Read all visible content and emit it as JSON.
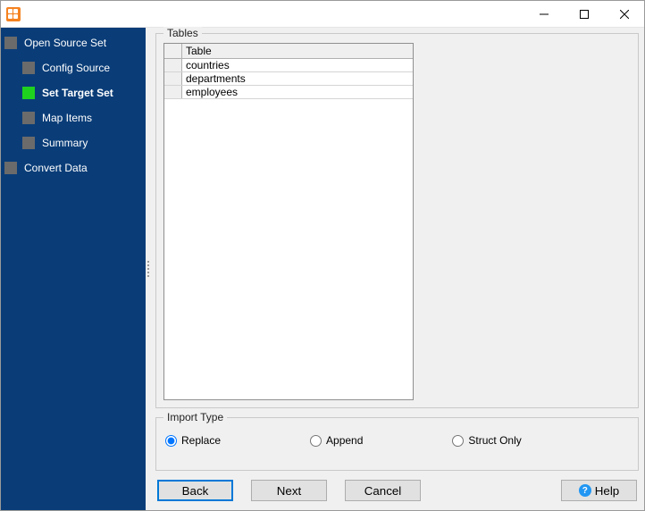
{
  "sidebar": {
    "steps": [
      {
        "label": "Open Source Set",
        "indent": false,
        "current": false
      },
      {
        "label": "Config Source",
        "indent": true,
        "current": false
      },
      {
        "label": "Set Target Set",
        "indent": true,
        "current": true
      },
      {
        "label": "Map Items",
        "indent": true,
        "current": false
      },
      {
        "label": "Summary",
        "indent": true,
        "current": false
      },
      {
        "label": "Convert Data",
        "indent": false,
        "current": false
      }
    ]
  },
  "tables_group": {
    "title": "Tables",
    "header": "Table",
    "rows": [
      "countries",
      "departments",
      "employees"
    ]
  },
  "import_group": {
    "title": "Import Type",
    "options": [
      {
        "label": "Replace",
        "value": "replace",
        "checked": true
      },
      {
        "label": "Append",
        "value": "append",
        "checked": false
      },
      {
        "label": "Struct Only",
        "value": "struct",
        "checked": false
      }
    ]
  },
  "buttons": {
    "back": "Back",
    "next": "Next",
    "cancel": "Cancel",
    "help": "Help"
  }
}
